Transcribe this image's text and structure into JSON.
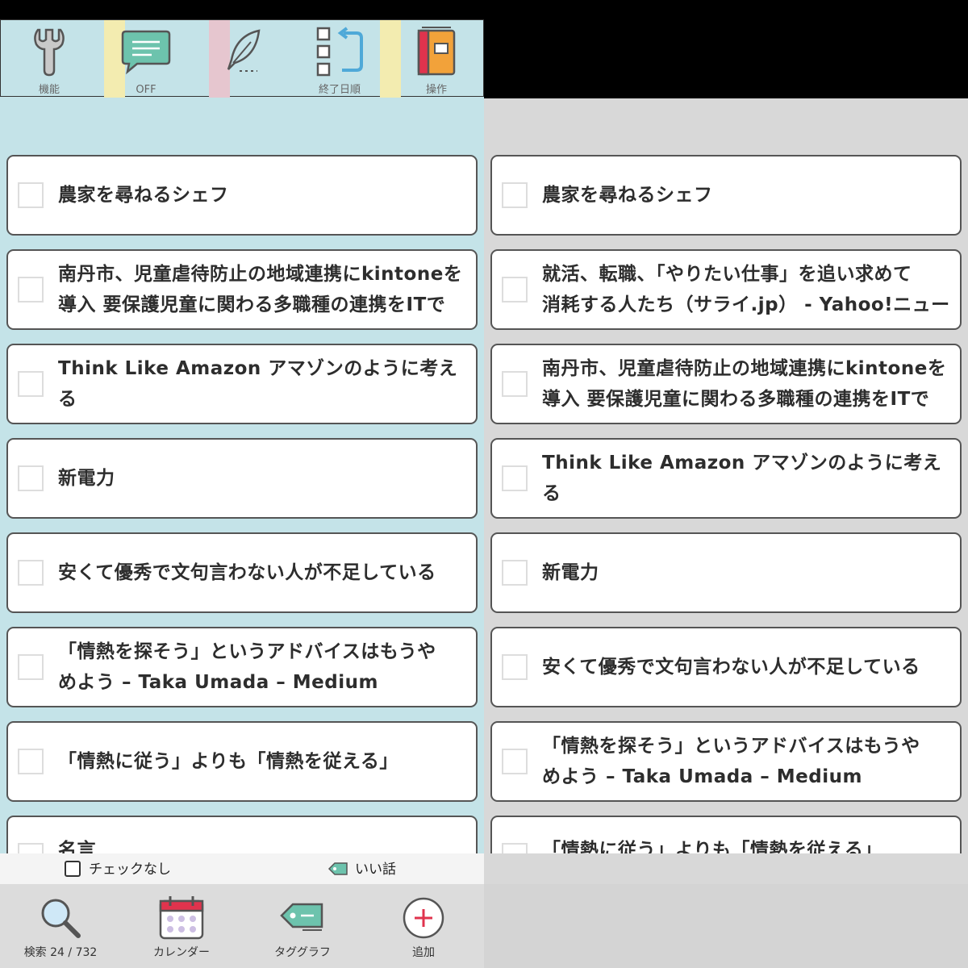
{
  "left": {
    "toolbar": [
      {
        "label": "機能",
        "icon": "wrench-icon"
      },
      {
        "label": "OFF",
        "icon": "chat-bubble-icon"
      },
      {
        "label": "",
        "icon": "feather-pen-icon"
      },
      {
        "label": "終了日順",
        "icon": "sort-list-icon"
      },
      {
        "label": "操作",
        "icon": "notebook-icon"
      }
    ],
    "items": [
      {
        "text": "農家を尋ねるシェフ"
      },
      {
        "text": "南丹市、児童虐待防止の地域連携にkintoneを\n導入 要保護児童に関わる多職種の連携をITで"
      },
      {
        "text": "Think Like Amazon アマゾンのように考える"
      },
      {
        "text": "新電力"
      },
      {
        "text": "安くて優秀で文句言わない人が不足している"
      },
      {
        "text": "「情熱を探そう」というアドバイスはもうや\nめよう – Taka Umada – Medium"
      },
      {
        "text": "「情熱に従う」よりも「情熱を従える」"
      },
      {
        "text": "名言"
      }
    ],
    "filter": {
      "check_label": "チェックなし",
      "tag_label": "いい話"
    },
    "nav": [
      {
        "label": "検索 24 / 732",
        "icon": "search-icon"
      },
      {
        "label": "カレンダー",
        "icon": "calendar-icon"
      },
      {
        "label": "タググラフ",
        "icon": "tag-icon"
      },
      {
        "label": "追加",
        "icon": "add-circle-icon"
      }
    ]
  },
  "right": {
    "items": [
      {
        "text": "農家を尋ねるシェフ"
      },
      {
        "text": "就活、転職、「やりたい仕事」を追い求めて\n消耗する人たち（サライ.jp） - Yahoo!ニュー"
      },
      {
        "text": "南丹市、児童虐待防止の地域連携にkintoneを\n導入 要保護児童に関わる多職種の連携をITで"
      },
      {
        "text": "Think Like Amazon アマゾンのように考える"
      },
      {
        "text": "新電力"
      },
      {
        "text": "安くて優秀で文句言わない人が不足している"
      },
      {
        "text": "「情熱を探そう」というアドバイスはもうや\nめよう – Taka Umada – Medium"
      },
      {
        "text": "「情熱に従う」よりも「情熱を従える」"
      }
    ]
  },
  "colors": {
    "teal_bg": "#c4e3e8",
    "yellow_stripe": "#f3ecb0",
    "pink_stripe": "#e6c6cf",
    "card_border": "#555555",
    "accent_red": "#e0334d",
    "tag_green": "#6dc3ad"
  }
}
